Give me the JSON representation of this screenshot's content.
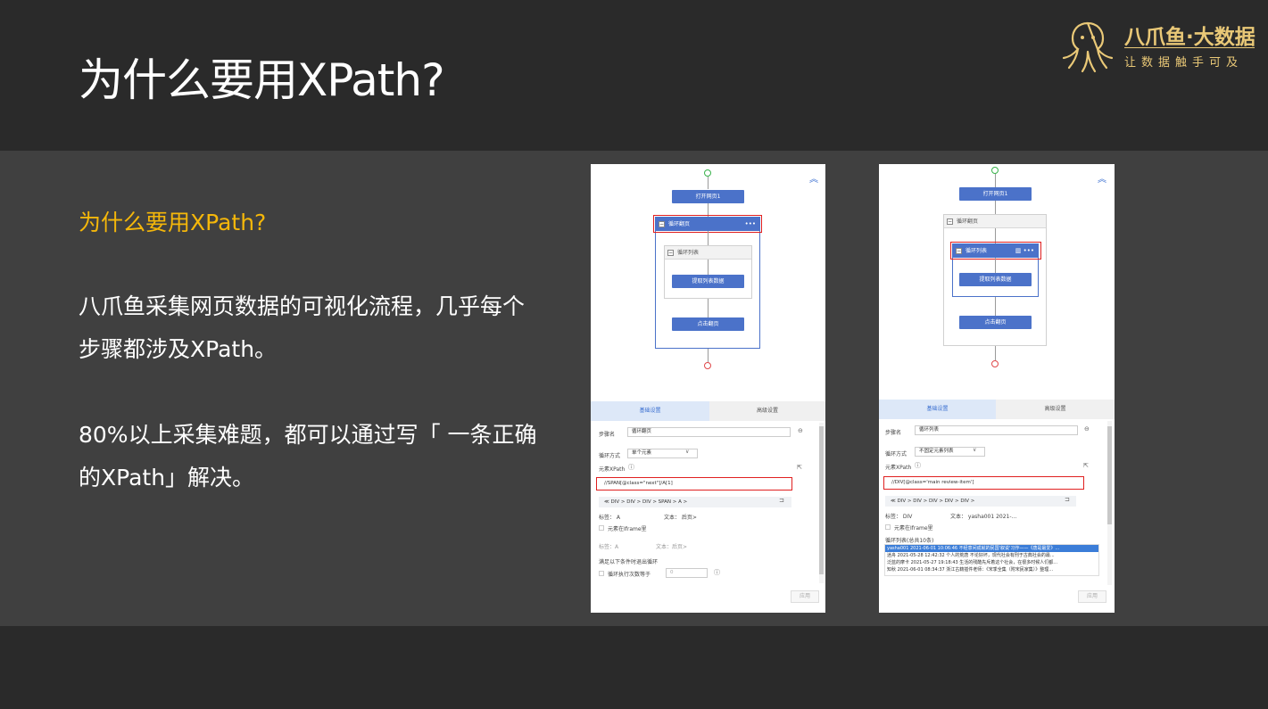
{
  "slide": {
    "title": "为什么要用XPath?",
    "subhead": "为什么要用XPath?",
    "paragraph1": "八爪鱼采集网页数据的可视化流程，几乎每个步骤都涉及XPath。",
    "paragraph2": "80%以上采集难题，都可以通过写「 一条正确的XPath」解决。"
  },
  "logo": {
    "name": "八爪鱼·大数据",
    "slogan": "让数据触手可及",
    "color": "#e9c877"
  },
  "colors": {
    "accent": "#f5b70a",
    "flow_blue": "#4b72c9",
    "highlight_red": "#e02020"
  },
  "left_panel": {
    "flow": {
      "open_page": "打开网页1",
      "loop_page": "循环翻页",
      "loop_list": "循环列表",
      "extract": "提取列表数据",
      "click_next": "点击翻页"
    },
    "tabs": {
      "basic": "基础设置",
      "advanced": "高级设置"
    },
    "form": {
      "step_name_label": "步骤名",
      "step_name_value": "循环翻页",
      "loop_mode_label": "循环方式",
      "loop_mode_value": "单个元素",
      "xpath_label": "元素XPath",
      "xpath_value": "//SPAN[@class=\"next\"]/A[1]",
      "crumbs": "≪  DIV  >  DIV  >  DIV  >  SPAN  >  A  >",
      "tag_label": "标签： A",
      "text_label": "文本： 后页>",
      "iframe_label": "元素在Iframe里",
      "tag_label2": "标签：A",
      "text_label2": "文本：后页>",
      "exit_condition": "满足以下条件时退出循环",
      "exit_count": "循环执行次数等于",
      "exit_count_value": "0",
      "apply": "应用"
    }
  },
  "right_panel": {
    "flow": {
      "open_page": "打开网页1",
      "loop_page": "循环翻页",
      "loop_list": "循环列表",
      "extract": "提取列表数据",
      "click_next": "点击翻页"
    },
    "tabs": {
      "basic": "基础设置",
      "advanced": "高级设置"
    },
    "form": {
      "step_name_label": "步骤名",
      "step_name_value": "循环列表",
      "loop_mode_label": "循环方式",
      "loop_mode_value": "不固定元素列表",
      "xpath_label": "元素XPath",
      "xpath_value": "//DIV[@class='main review-item']",
      "crumbs": "≪  DIV  >  DIV  >  DIV  >  DIV  >  DIV  >",
      "tag_label": "标签： DIV",
      "text_label": "文本： yasha001 2021-...",
      "iframe_label": "元素在Iframe里",
      "list_label": "循环列表(总共10条)",
      "list_items": [
        "yasha001 2021-06-01 10:06:46 不经意间成就的民国'叙说'习作——《唐是最爱》...",
        "迷舟 2021-05-28 12:42:32 个人的荒唐 不论好坏，现代社会有刑于古典社会的最...",
        "泛蓝的摩卡 2021-05-27 19:18:43 生活的残酷先斥着这个社会，在很多时候人们都...",
        "知秋 2021-06-01 08:34:37 浙江古籍插件老师：《宋季全集（附宋民家集）》整理..."
      ],
      "apply": "应用"
    }
  }
}
